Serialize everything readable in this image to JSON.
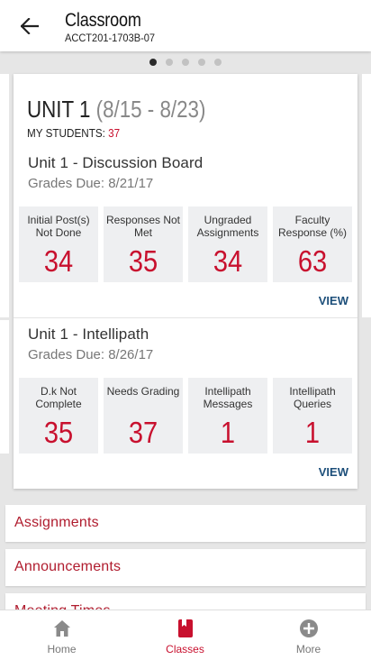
{
  "header": {
    "title": "Classroom",
    "subtitle": "ACCT201-1703B-07"
  },
  "pager": {
    "count": 5,
    "active_index": 0
  },
  "unit": {
    "title": "UNIT 1",
    "dates": "(8/15 - 8/23)",
    "students_label": "MY STUDENTS:",
    "students_count": "37"
  },
  "sections": [
    {
      "title": "Unit 1 - Discussion Board",
      "due": "Grades Due: 8/21/17",
      "stats": [
        {
          "label": "Initial Post(s) Not Done",
          "value": "34"
        },
        {
          "label": "Responses Not Met",
          "value": "35"
        },
        {
          "label": "Ungraded Assignments",
          "value": "34"
        },
        {
          "label": "Faculty Response (%)",
          "value": "63"
        }
      ],
      "view_label": "VIEW"
    },
    {
      "title": "Unit 1 - Intellipath",
      "due": "Grades Due: 8/26/17",
      "stats": [
        {
          "label": "D.k Not Complete",
          "value": "35"
        },
        {
          "label": "Needs Grading",
          "value": "37"
        },
        {
          "label": "Intellipath Messages",
          "value": "1"
        },
        {
          "label": "Intellipath Queries",
          "value": "1"
        }
      ],
      "view_label": "VIEW"
    }
  ],
  "links": [
    {
      "label": "Assignments"
    },
    {
      "label": "Announcements"
    },
    {
      "label": "Meeting Times"
    }
  ],
  "nav": [
    {
      "label": "Home",
      "icon": "home-icon"
    },
    {
      "label": "Classes",
      "icon": "book-icon",
      "active": true
    },
    {
      "label": "More",
      "icon": "plus-circle-icon"
    }
  ],
  "colors": {
    "accent_red": "#c8102e",
    "link_red": "#b01c2e",
    "view_blue": "#1d4f7a"
  }
}
